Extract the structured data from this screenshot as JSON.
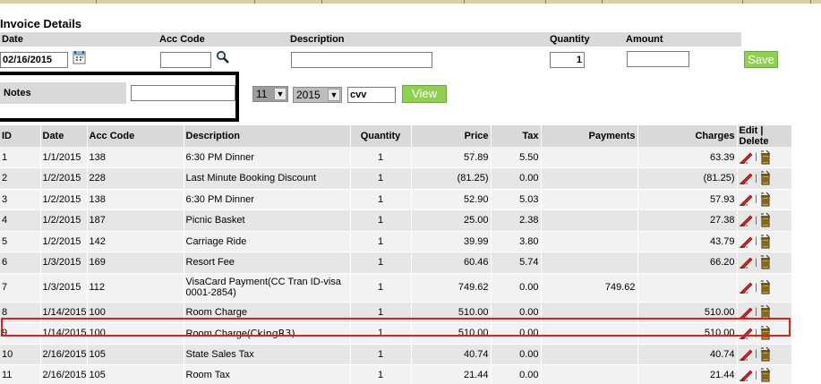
{
  "title": "Invoice Details",
  "form": {
    "headers": {
      "date": "Date",
      "acc_code": "Acc Code",
      "description": "Description",
      "quantity": "Quantity",
      "amount": "Amount"
    },
    "date_value": "02/16/2015",
    "acc_code_value": "",
    "description_value": "",
    "quantity_value": "1",
    "amount_value": "",
    "save_label": "Save"
  },
  "notes": {
    "label": "Notes",
    "value": ""
  },
  "filter": {
    "month": "11",
    "year": "2015",
    "code": "cvv",
    "view_label": "View"
  },
  "table": {
    "columns": [
      "ID",
      "Date",
      "Acc Code",
      "Description",
      "Quantity",
      "Price",
      "Tax",
      "Payments",
      "Charges",
      "Edit | Delete"
    ],
    "rows": [
      {
        "id": "1",
        "date": "1/1/2015",
        "acc": "138",
        "desc": "6:30 PM Dinner",
        "qty": "1",
        "price": "57.89",
        "tax": "5.50",
        "payments": "",
        "charges": "63.39"
      },
      {
        "id": "2",
        "date": "1/2/2015",
        "acc": "228",
        "desc": "Last Minute Booking Discount",
        "qty": "1",
        "price": "(81.25)",
        "tax": "0.00",
        "payments": "",
        "charges": "(81.25)"
      },
      {
        "id": "3",
        "date": "1/2/2015",
        "acc": "138",
        "desc": "6:30 PM Dinner",
        "qty": "1",
        "price": "52.90",
        "tax": "5.03",
        "payments": "",
        "charges": "57.93"
      },
      {
        "id": "4",
        "date": "1/2/2015",
        "acc": "187",
        "desc": "Picnic Basket",
        "qty": "1",
        "price": "25.00",
        "tax": "2.38",
        "payments": "",
        "charges": "27.38"
      },
      {
        "id": "5",
        "date": "1/2/2015",
        "acc": "142",
        "desc": "Carriage Ride",
        "qty": "1",
        "price": "39.99",
        "tax": "3.80",
        "payments": "",
        "charges": "43.79"
      },
      {
        "id": "6",
        "date": "1/3/2015",
        "acc": "169",
        "desc": "Resort Fee",
        "qty": "1",
        "price": "60.46",
        "tax": "5.74",
        "payments": "",
        "charges": "66.20"
      },
      {
        "id": "7",
        "date": "1/3/2015",
        "acc": "112",
        "desc": "VisaCard Payment(CC Tran ID-visa 0001-2854)",
        "qty": "1",
        "price": "749.62",
        "tax": "0.00",
        "payments": "749.62",
        "charges": ""
      },
      {
        "id": "8",
        "date": "1/14/2015",
        "acc": "100",
        "desc": "Room Charge",
        "qty": "1",
        "price": "510.00",
        "tax": "0.00",
        "payments": "",
        "charges": "510.00"
      },
      {
        "id": "9",
        "date": "1/14/2015",
        "acc": "100",
        "desc": "Room Charge(",
        "desc_note": "CkingR3)",
        "qty": "1",
        "price": "510.00",
        "tax": "0.00",
        "payments": "",
        "charges": "510.00"
      },
      {
        "id": "10",
        "date": "2/16/2015",
        "acc": "105",
        "desc": "State Sales Tax",
        "qty": "1",
        "price": "40.74",
        "tax": "0.00",
        "payments": "",
        "charges": "40.74"
      },
      {
        "id": "11",
        "date": "2/16/2015",
        "acc": "105",
        "desc": "Room Tax",
        "qty": "1",
        "price": "21.44",
        "tax": "0.00",
        "payments": "",
        "charges": "21.44"
      }
    ]
  },
  "icons": {
    "calendar": "calendar-icon",
    "search": "magnifier-search-icon",
    "edit": "pencil-edit-icon",
    "delete": "trash-delete-icon"
  },
  "colors": {
    "header_gray": "#d9d9d9",
    "button_green": "#8fd14f",
    "highlight_red": "#e02020"
  }
}
